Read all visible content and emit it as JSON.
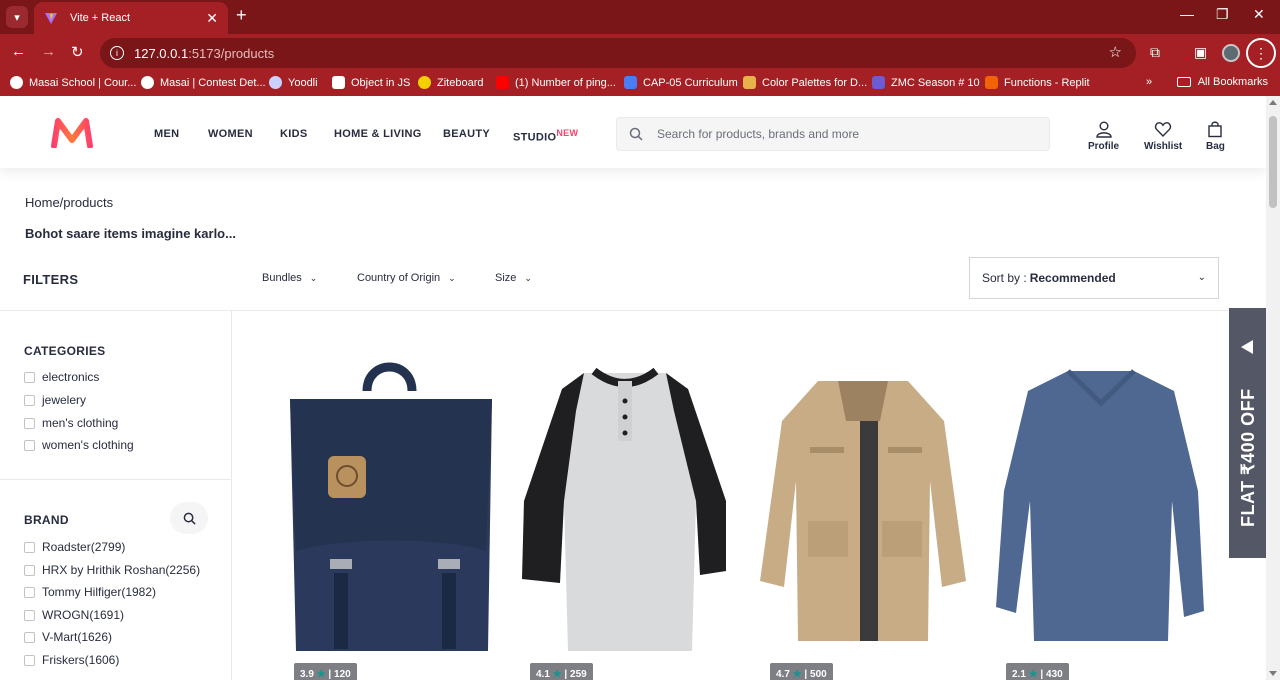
{
  "browser": {
    "tab_title": "Vite + React",
    "url_host": "127.0.0.1",
    "url_path": ":5173/products",
    "bookmarks": [
      {
        "label": "Masai School | Cour...",
        "color": "#ffffff"
      },
      {
        "label": "Masai | Contest Det...",
        "color": "#ffffff"
      },
      {
        "label": "Yoodli",
        "color": "#c9d2ff"
      },
      {
        "label": "Object in JS",
        "color": "#ffffff"
      },
      {
        "label": "Ziteboard",
        "color": "#f4d000"
      },
      {
        "label": "(1) Number of ping...",
        "color": "#ff0000"
      },
      {
        "label": "CAP-05 Curriculum",
        "color": "#4a7cf3"
      },
      {
        "label": "Color Palettes for D...",
        "color": "#e8b24a"
      },
      {
        "label": "ZMC Season # 10",
        "color": "#6b5bd6"
      },
      {
        "label": "Functions - Replit",
        "color": "#f26207"
      }
    ],
    "overflow": "»",
    "all_bookmarks": "All Bookmarks"
  },
  "header": {
    "nav": [
      "MEN",
      "WOMEN",
      "KIDS",
      "HOME & LIVING",
      "BEAUTY",
      "STUDIO"
    ],
    "studio_badge": "NEW",
    "search_placeholder": "Search for products, brands and more",
    "actions": {
      "profile": "Profile",
      "wishlist": "Wishlist",
      "bag": "Bag"
    }
  },
  "breadcrumb": "Home/products",
  "tagline": "Bohot saare items imagine karlo...",
  "filters": {
    "title": "FILTERS",
    "dropdowns": [
      "Bundles",
      "Country of Origin",
      "Size"
    ],
    "sort_label": "Sort by :",
    "sort_value": "Recommended"
  },
  "sidebar": {
    "categories_title": "CATEGORIES",
    "categories": [
      "electronics",
      "jewelery",
      "men's clothing",
      "women's clothing"
    ],
    "brand_title": "BRAND",
    "brands": [
      "Roadster(2799)",
      "HRX by Hrithik Roshan(2256)",
      "Tommy Hilfiger(1982)",
      "WROGN(1691)",
      "V-Mart(1626)",
      "Friskers(1606)"
    ]
  },
  "products": [
    {
      "rating": "3.9",
      "count": "120",
      "icon": "backpack-image"
    },
    {
      "rating": "4.1",
      "count": "259",
      "icon": "raglan-tshirt-image"
    },
    {
      "rating": "4.7",
      "count": "500",
      "icon": "jacket-image"
    },
    {
      "rating": "2.1",
      "count": "430",
      "icon": "long-sleeve-tshirt-image"
    }
  ],
  "promo": "FLAT ₹400 OFF",
  "colors": {
    "accent": "#ff3f6c",
    "browser_frame": "#a52024",
    "rating_badge": "#7d7f85",
    "promo_bg": "#535766"
  }
}
